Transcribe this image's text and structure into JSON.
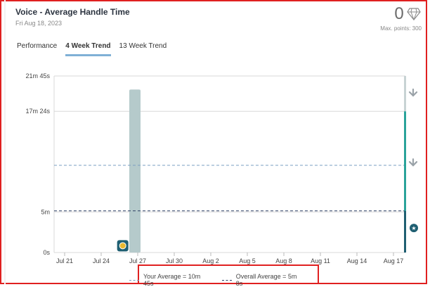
{
  "header": {
    "title": "Voice - Average Handle Time",
    "date": "Fri Aug 18, 2023",
    "points_value": "0",
    "max_points": "Max. points: 300"
  },
  "tabs": [
    {
      "label": "Performance",
      "active": false
    },
    {
      "label": "4 Week Trend",
      "active": true
    },
    {
      "label": "13 Week Trend",
      "active": false
    }
  ],
  "legend": {
    "your_average": "Your Average = 10m 45s",
    "overall_average": "Overall Average = 5m 8s"
  },
  "colors": {
    "bar": "#b5cacb",
    "your_average_line": "#7a9fc0",
    "overall_average_line": "#2c3e63",
    "threshold_green": "#2aa39a",
    "threshold_dark": "#1f5f72",
    "threshold_gray": "#c8d3d4",
    "arrow_gray": "#9aa2a8",
    "star_badge": "#1f5f72",
    "marker_badge": "#1f5f72",
    "marker_coin": "#e8b830"
  },
  "chart_data": {
    "type": "bar",
    "y_unit": "seconds",
    "ylim": [
      0,
      1305
    ],
    "y_ticks": [
      {
        "value": 0,
        "label": "0s"
      },
      {
        "value": 300,
        "label": "5m"
      },
      {
        "value": 1044,
        "label": "17m 24s"
      },
      {
        "value": 1305,
        "label": "21m 45s"
      }
    ],
    "x_start_label": "Jul 21",
    "x_span_days": 28,
    "x_ticks": [
      "Jul 21",
      "Jul 24",
      "Jul 27",
      "Jul 30",
      "Aug 2",
      "Aug 5",
      "Aug 8",
      "Aug 11",
      "Aug 14",
      "Aug 17"
    ],
    "bars": [
      {
        "date": "Jul 27",
        "value": 1205
      }
    ],
    "your_average_seconds": 645,
    "overall_average_seconds": 308,
    "thresholds": [
      {
        "from": 0,
        "to": 308,
        "level": "dark"
      },
      {
        "from": 308,
        "to": 1044,
        "level": "green"
      },
      {
        "from": 1044,
        "to": 1305,
        "level": "gray"
      }
    ],
    "markers": [
      {
        "date": "Jul 26",
        "value": 45,
        "icon": "achievement-badge-icon"
      }
    ]
  }
}
